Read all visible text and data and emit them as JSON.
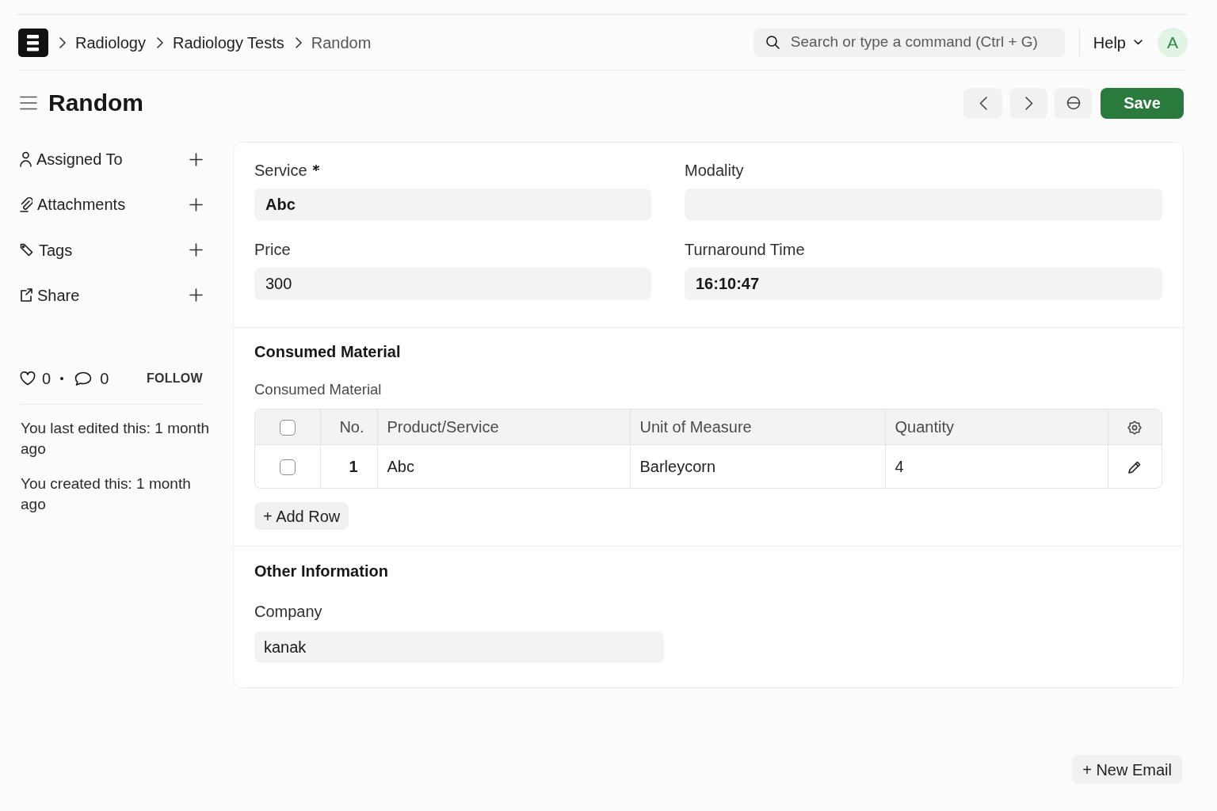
{
  "navbar": {
    "breadcrumbs": [
      {
        "label": "Radiology",
        "current": false
      },
      {
        "label": "Radiology Tests",
        "current": false
      },
      {
        "label": "Random",
        "current": true
      }
    ],
    "search": {
      "placeholder": "Search or type a command (Ctrl + G)"
    },
    "help": "Help",
    "avatar": "A"
  },
  "page": {
    "title": "Random",
    "save": "Save"
  },
  "sidebar": {
    "items": [
      {
        "kind": "assign",
        "label": "Assigned To"
      },
      {
        "kind": "attachment",
        "label": "Attachments"
      },
      {
        "kind": "tag",
        "label": "Tags"
      },
      {
        "kind": "share",
        "label": "Share"
      }
    ],
    "likes": "0",
    "comments": "0",
    "follow": "FOLLOW",
    "notes": [
      "You last edited this: 1 month ago",
      "You created this: 1 month ago"
    ]
  },
  "form": {
    "sections": [
      {
        "columns": [
          [
            {
              "label": "Service",
              "required": true,
              "value": "Abc",
              "bold": true
            },
            {
              "label": "Price",
              "required": false,
              "value": "300",
              "bold": false
            }
          ],
          [
            {
              "label": "Modality",
              "required": false
            },
            {
              "label": "Turnaround Time",
              "required": false,
              "value": "16:10:47",
              "bold": true
            }
          ]
        ]
      },
      {
        "heading": "Consumed Material",
        "table": {
          "label": "Consumed Material",
          "select_all": {
            "checked": false
          },
          "columns": [
            "No.",
            "Product/Service",
            "Unit of Measure",
            "Quantity"
          ],
          "rows": [
            {
              "checked": false,
              "cells": [
                "1",
                "Abc",
                "Barleycorn",
                "4"
              ]
            }
          ],
          "add_row": "+ Add Row"
        }
      },
      {
        "heading": "Other Information",
        "columns": [
          [
            {
              "label": "Company",
              "required": false,
              "value": "kanak",
              "bold": false
            }
          ]
        ]
      }
    ]
  },
  "footer": {
    "new_email": "+ New Email"
  }
}
